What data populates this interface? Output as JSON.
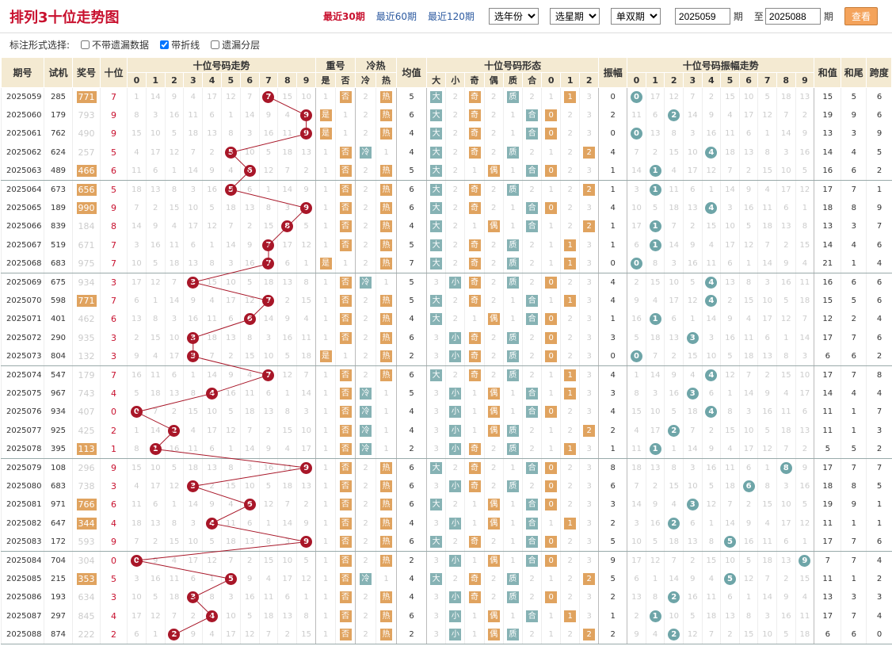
{
  "header": {
    "title": "排列3十位走势图",
    "nav": [
      "最近30期",
      "最近60期",
      "最近120期"
    ],
    "sel_year": "选年份",
    "sel_period": "选星期",
    "sel_parity": "单双期",
    "from": "2025059",
    "qi": "期",
    "to_label": "至",
    "to": "2025088",
    "qi2": "期",
    "query": "查看"
  },
  "marks": {
    "label": "标注形式选择:",
    "o1": "不带遗漏数据",
    "o2": "带折线",
    "o3": "遗漏分层"
  },
  "cols": {
    "qh": "期号",
    "sj": "试机",
    "jh": "奖号",
    "sw": "十位",
    "trend": "十位号码走势",
    "cf": "重号",
    "lr": "冷热",
    "jz": "均值",
    "xt": "十位号码形态",
    "zf": "振幅",
    "zft": "十位号码振幅走势",
    "hz": "和值",
    "hw": "和尾",
    "kd": "跨度",
    "shi": "是",
    "fou": "否",
    "leng": "冷",
    "re": "热",
    "da": "大",
    "xiao": "小",
    "ji": "奇",
    "ou": "偶",
    "zhi": "质",
    "he": "合"
  },
  "digits": [
    "0",
    "1",
    "2",
    "3",
    "4",
    "5",
    "6",
    "7",
    "8",
    "9"
  ],
  "rows": [
    [
      "2025059",
      "285",
      "771",
      "7",
      1,
      "771"
    ],
    [
      "2025060",
      "179",
      "793",
      "9",
      0,
      ""
    ],
    [
      "2025061",
      "762",
      "490",
      "9",
      0,
      ""
    ],
    [
      "2025062",
      "624",
      "257",
      "5",
      0,
      ""
    ],
    [
      "2025063",
      "489",
      "466",
      "6",
      1,
      "466"
    ],
    [
      "2025064",
      "673",
      "656",
      "5",
      1,
      "656"
    ],
    [
      "2025065",
      "189",
      "990",
      "9",
      1,
      "990"
    ],
    [
      "2025066",
      "839",
      "184",
      "8",
      0,
      ""
    ],
    [
      "2025067",
      "519",
      "671",
      "7",
      0,
      ""
    ],
    [
      "2025068",
      "683",
      "975",
      "7",
      0,
      ""
    ],
    [
      "2025069",
      "675",
      "934",
      "3",
      0,
      ""
    ],
    [
      "2025070",
      "598",
      "771",
      "7",
      1,
      "771"
    ],
    [
      "2025071",
      "401",
      "462",
      "6",
      0,
      ""
    ],
    [
      "2025072",
      "290",
      "935",
      "3",
      0,
      ""
    ],
    [
      "2025073",
      "804",
      "132",
      "3",
      0,
      ""
    ],
    [
      "2025074",
      "547",
      "179",
      "7",
      0,
      ""
    ],
    [
      "2025075",
      "967",
      "743",
      "4",
      0,
      ""
    ],
    [
      "2025076",
      "934",
      "407",
      "0",
      0,
      ""
    ],
    [
      "2025077",
      "925",
      "425",
      "2",
      0,
      ""
    ],
    [
      "2025078",
      "395",
      "113",
      "1",
      1,
      "113"
    ],
    [
      "2025079",
      "108",
      "296",
      "9",
      0,
      ""
    ],
    [
      "2025080",
      "683",
      "738",
      "3",
      0,
      ""
    ],
    [
      "2025081",
      "971",
      "766",
      "6",
      1,
      "766"
    ],
    [
      "2025082",
      "647",
      "344",
      "4",
      1,
      "344"
    ],
    [
      "2025083",
      "172",
      "593",
      "9",
      0,
      ""
    ],
    [
      "2025084",
      "704",
      "304",
      "0",
      0,
      ""
    ],
    [
      "2025085",
      "215",
      "353",
      "5",
      1,
      "353"
    ],
    [
      "2025086",
      "193",
      "634",
      "3",
      0,
      ""
    ],
    [
      "2025087",
      "297",
      "845",
      "4",
      0,
      ""
    ],
    [
      "2025088",
      "874",
      "222",
      "2",
      0,
      ""
    ]
  ],
  "extra": [
    [
      0,
      "热",
      "5",
      "大",
      "奇",
      "质",
      1,
      "0",
      "0",
      15,
      5,
      6
    ],
    [
      1,
      "热",
      "6",
      "大",
      "奇",
      "合",
      0,
      "2",
      "2",
      19,
      9,
      6
    ],
    [
      1,
      "热",
      "4",
      "大",
      "奇",
      "合",
      0,
      "0",
      "0",
      13,
      3,
      9
    ],
    [
      0,
      "冷",
      "4",
      "大",
      "奇",
      "质",
      2,
      "4",
      "4",
      14,
      4,
      5
    ],
    [
      0,
      "热",
      "5",
      "大",
      "偶",
      "合",
      0,
      "1",
      "1",
      16,
      6,
      2
    ],
    [
      0,
      "热",
      "6",
      "大",
      "奇",
      "质",
      2,
      "1",
      "1",
      17,
      7,
      1
    ],
    [
      0,
      "热",
      "6",
      "大",
      "奇",
      "合",
      0,
      "4",
      "4",
      18,
      8,
      9
    ],
    [
      0,
      "热",
      "4",
      "大",
      "偶",
      "合",
      2,
      "1",
      "1",
      13,
      3,
      7
    ],
    [
      0,
      "热",
      "5",
      "大",
      "奇",
      "质",
      1,
      "1",
      "1",
      14,
      4,
      6
    ],
    [
      1,
      "热",
      "7",
      "大",
      "奇",
      "质",
      1,
      "0",
      "0",
      21,
      1,
      4
    ],
    [
      0,
      "冷",
      "5",
      "小",
      "奇",
      "质",
      0,
      "4",
      "4",
      16,
      6,
      6
    ],
    [
      0,
      "热",
      "5",
      "大",
      "奇",
      "合",
      1,
      "4",
      "4",
      15,
      5,
      6
    ],
    [
      0,
      "热",
      "4",
      "大",
      "偶",
      "合",
      0,
      "1",
      "1",
      12,
      2,
      4
    ],
    [
      0,
      "热",
      "6",
      "小",
      "奇",
      "质",
      0,
      "3",
      "3",
      17,
      7,
      6
    ],
    [
      1,
      "热",
      "2",
      "小",
      "奇",
      "质",
      0,
      "0",
      "0",
      6,
      6,
      2
    ],
    [
      0,
      "热",
      "6",
      "大",
      "奇",
      "质",
      1,
      "4",
      "4",
      17,
      7,
      8
    ],
    [
      0,
      "冷",
      "5",
      "小",
      "偶",
      "合",
      1,
      "3",
      "3",
      14,
      4,
      4
    ],
    [
      0,
      "冷",
      "4",
      "小",
      "偶",
      "合",
      0,
      "4",
      "4",
      11,
      1,
      7
    ],
    [
      0,
      "冷",
      "4",
      "小",
      "偶",
      "质",
      2,
      "2",
      "2",
      11,
      1,
      3
    ],
    [
      0,
      "冷",
      "2",
      "小",
      "奇",
      "质",
      1,
      "1",
      "1",
      5,
      5,
      2
    ],
    [
      0,
      "热",
      "6",
      "大",
      "奇",
      "合",
      0,
      "8",
      "8",
      17,
      7,
      7
    ],
    [
      0,
      "热",
      "6",
      "小",
      "奇",
      "质",
      0,
      "6",
      "6",
      18,
      8,
      5
    ],
    [
      0,
      "热",
      "6",
      "大",
      "偶",
      "合",
      0,
      "3",
      "3",
      19,
      9,
      1
    ],
    [
      0,
      "热",
      "4",
      "小",
      "偶",
      "合",
      1,
      "2",
      "2",
      11,
      1,
      1
    ],
    [
      0,
      "热",
      "6",
      "大",
      "奇",
      "合",
      0,
      "5",
      "5",
      17,
      7,
      6
    ],
    [
      0,
      "热",
      "2",
      "小",
      "偶",
      "合",
      0,
      "9",
      "9",
      7,
      7,
      4
    ],
    [
      0,
      "冷",
      "4",
      "大",
      "奇",
      "质",
      2,
      "5",
      "5",
      11,
      1,
      2
    ],
    [
      0,
      "热",
      "4",
      "小",
      "奇",
      "质",
      0,
      "2",
      "2",
      13,
      3,
      3
    ],
    [
      0,
      "热",
      "6",
      "小",
      "偶",
      "合",
      1,
      "1",
      "1",
      17,
      7,
      4
    ],
    [
      0,
      "热",
      "2",
      "小",
      "偶",
      "质",
      2,
      "2",
      "2",
      6,
      6,
      0
    ]
  ]
}
